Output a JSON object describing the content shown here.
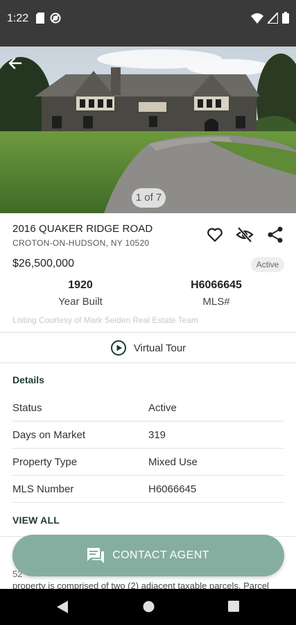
{
  "status_bar": {
    "time": "1:22",
    "left_icons": [
      "sd-card-icon",
      "at-sign-icon"
    ],
    "right_icons": [
      "wifi-icon",
      "signal-icon",
      "battery-icon"
    ]
  },
  "gallery": {
    "counter": "1 of 7",
    "image": "house-photo"
  },
  "listing": {
    "address": "2016 QUAKER RIDGE ROAD",
    "city": "CROTON-ON-HUDSON, NY 10520",
    "price": "$26,500,000",
    "status_badge": "Active",
    "year_built_value": "1920",
    "year_built_label": "Year Built",
    "mls_value": "H6066645",
    "mls_label": "MLS#",
    "courtesy": "Listing Courtesy of Mark Seiden Real Estate Team"
  },
  "virtual_tour": {
    "label": "Virtual Tour"
  },
  "details": {
    "heading": "Details",
    "rows": [
      {
        "label": "Status",
        "value": "Active"
      },
      {
        "label": "Days on Market",
        "value": "319"
      },
      {
        "label": "Property Type",
        "value": "Mixed Use"
      },
      {
        "label": "MLS Number",
        "value": "H6066645"
      }
    ],
    "view_all": "VIEW ALL"
  },
  "description": {
    "line1": "52",
    "line2": "property is comprised of two (2) adjacent taxable parcels. Parcel"
  },
  "contact": {
    "label": "CONTACT AGENT"
  },
  "colors": {
    "accent": "#1e3a34",
    "contact_button": "#86aea0",
    "status_bar": "#3a3a3a"
  }
}
